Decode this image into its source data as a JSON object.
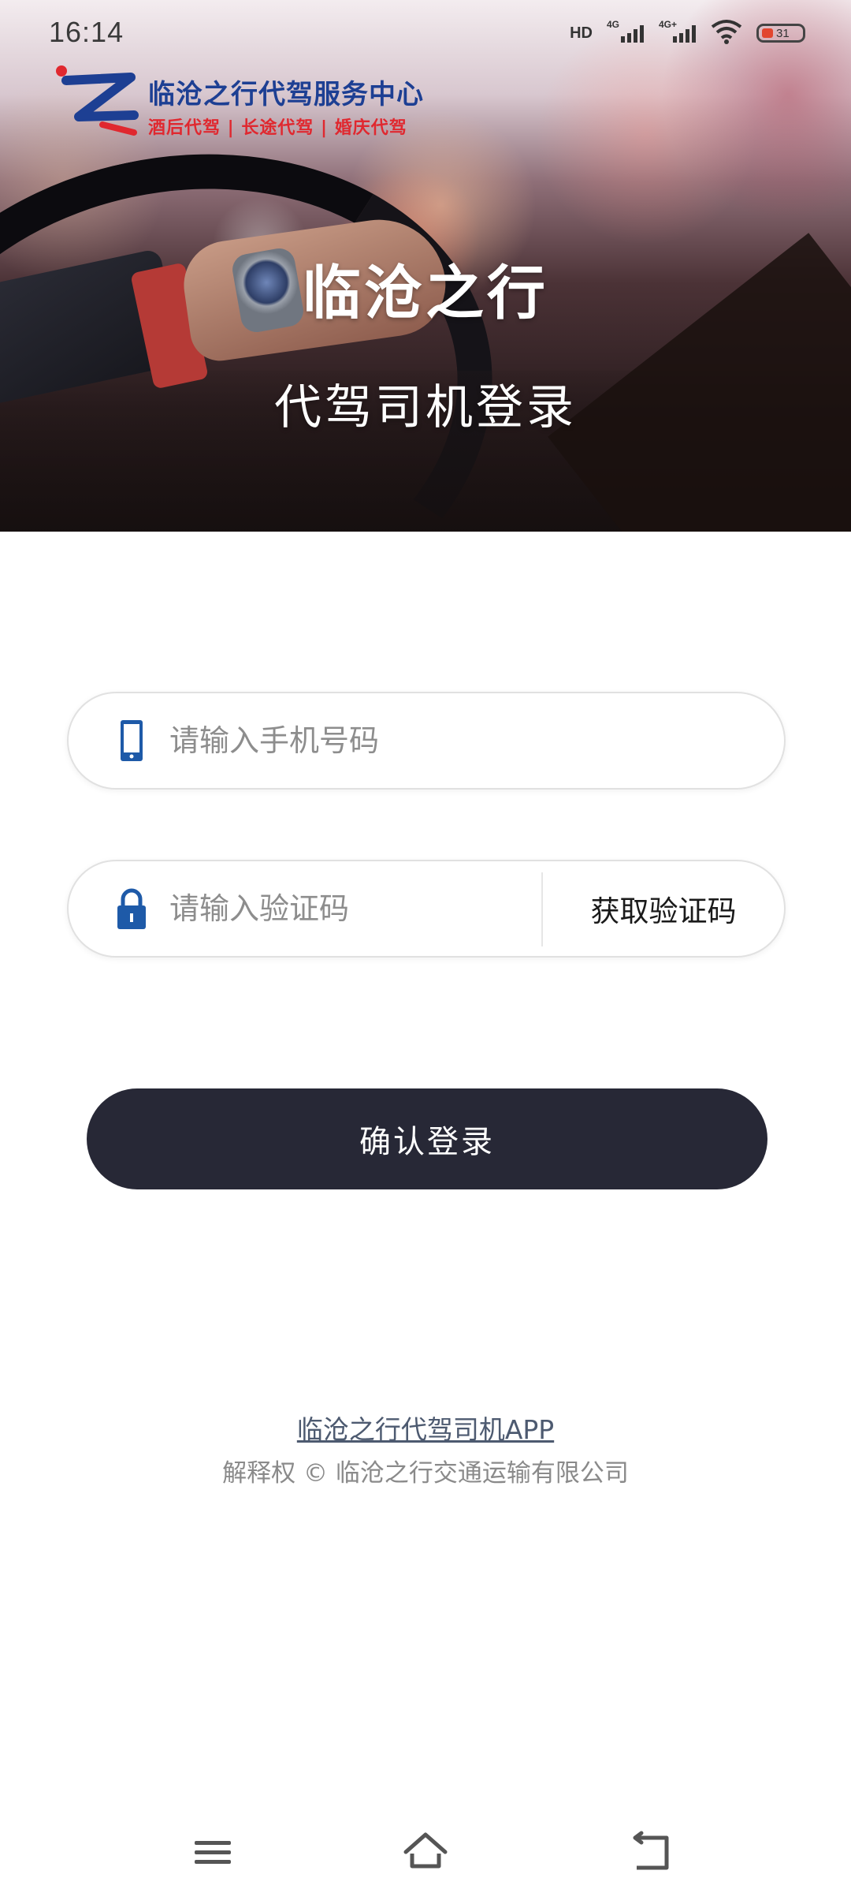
{
  "status_bar": {
    "time": "16:14",
    "hd_label": "HD",
    "net1": "4G",
    "net2": "4G+",
    "battery_level": "31"
  },
  "brand": {
    "name": "临沧之行代驾服务中心",
    "slogan": "酒后代驾 | 长途代驾 | 婚庆代驾",
    "primary_color": "#1d3f93",
    "accent_color": "#e0282f"
  },
  "hero": {
    "title": "临沧之行",
    "subtitle": "代驾司机登录"
  },
  "form": {
    "phone": {
      "placeholder": "请输入手机号码",
      "value": "",
      "icon": "phone-icon"
    },
    "code": {
      "placeholder": "请输入验证码",
      "value": "",
      "icon": "lock-icon",
      "get_code_label": "获取验证码"
    },
    "submit_label": "确认登录",
    "submit_color": "#272836"
  },
  "footer": {
    "link": "临沧之行代驾司机APP",
    "copyright": "解释权 © 临沧之行交通运输有限公司"
  },
  "nav_bar": {
    "icons": [
      "menu-icon",
      "home-icon",
      "back-icon"
    ]
  }
}
